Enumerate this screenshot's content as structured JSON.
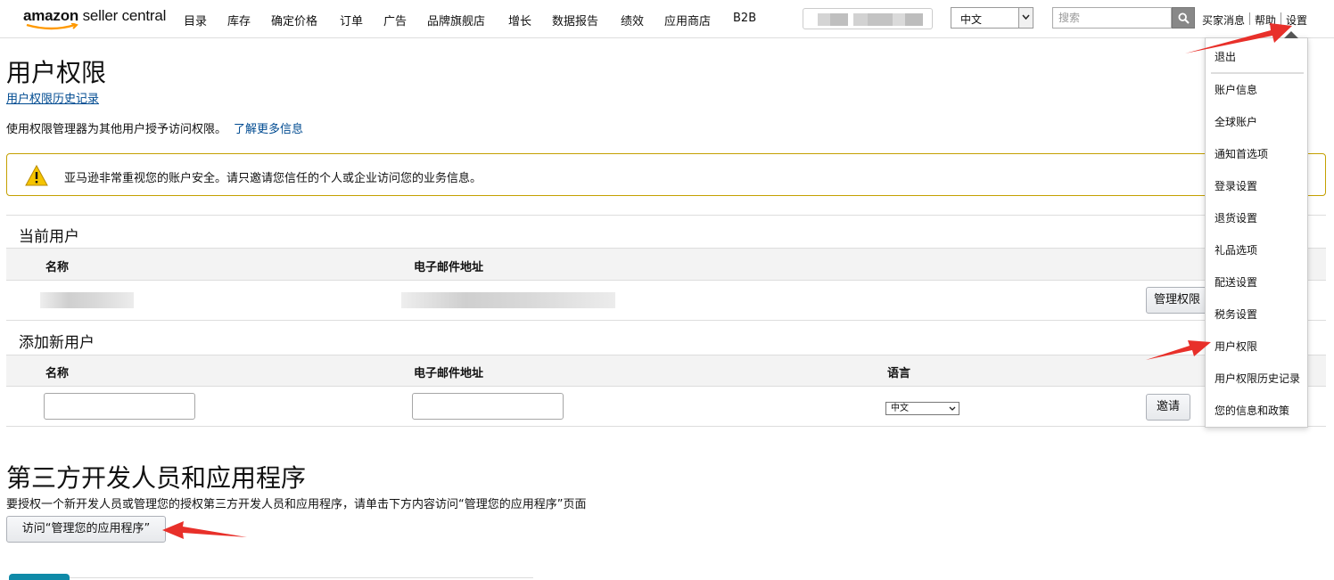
{
  "brand": {
    "word1": "amazon",
    "word2": " seller central"
  },
  "nav": [
    "目录",
    "库存",
    "确定价格",
    "订单",
    "广告",
    "品牌旗舰店",
    "增长",
    "数据报告",
    "绩效",
    "应用商店",
    "B2B"
  ],
  "header": {
    "language": "中文",
    "search_placeholder": "搜索",
    "buyer_messages": "买家消息",
    "help": "帮助",
    "settings": "设置"
  },
  "page": {
    "title": "用户权限",
    "history_link": "用户权限历史记录",
    "intro": "使用权限管理器为其他用户授予访问权限。",
    "learn_more": "了解更多信息",
    "alert": "亚马逊非常重视您的账户安全。请只邀请您信任的个人或企业访问您的业务信息。"
  },
  "current_users": {
    "heading": "当前用户",
    "col_name": "名称",
    "col_email": "电子邮件地址",
    "manage_button": "管理权限"
  },
  "add_user": {
    "heading": "添加新用户",
    "col_name": "名称",
    "col_email": "电子邮件地址",
    "col_language": "语言",
    "language_value": "中文",
    "invite_button": "邀请"
  },
  "third_party": {
    "heading": "第三方开发人员和应用程序",
    "description": "要授权一个新开发人员或管理您的授权第三方开发人员和应用程序，请单击下方内容访问“管理您的应用程序”页面",
    "button": "访问“管理您的应用程序”"
  },
  "settings_menu": [
    "退出",
    "账户信息",
    "全球账户",
    "通知首选项",
    "登录设置",
    "退货设置",
    "礼品选项",
    "配送设置",
    "税务设置",
    "用户权限",
    "用户权限历史记录",
    "您的信息和政策"
  ],
  "colors": {
    "link": "#004b91",
    "alert_border": "#c4a000",
    "arrow": "#e8302a"
  }
}
